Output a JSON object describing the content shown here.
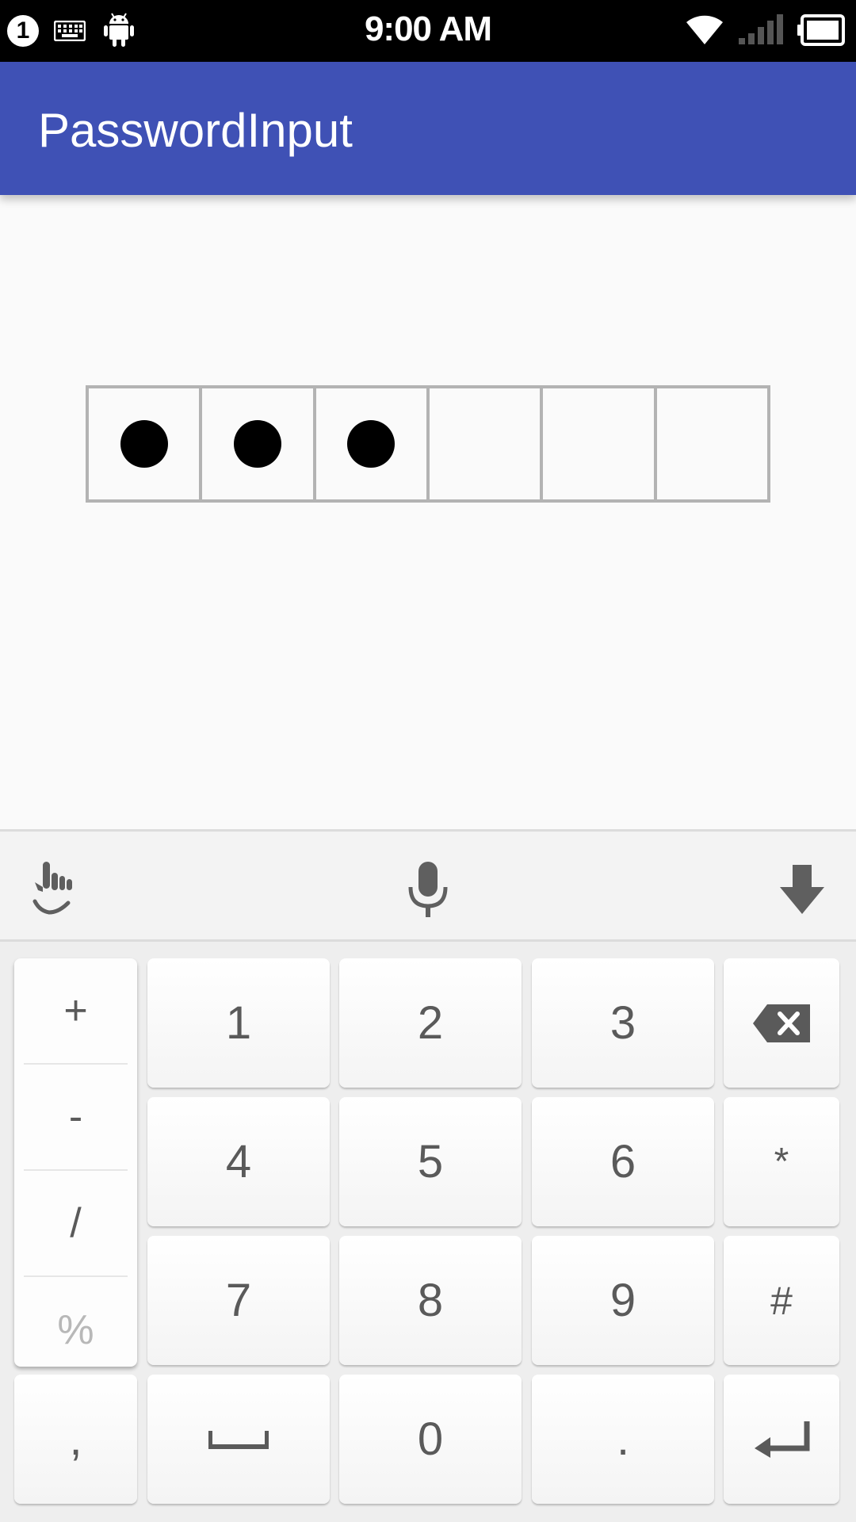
{
  "status_bar": {
    "notification_count": "1",
    "time": "9:00 AM",
    "icons": [
      "keyboard-icon",
      "android-icon",
      "wifi-icon",
      "signal-icon",
      "battery-icon"
    ]
  },
  "app_bar": {
    "title": "PasswordInput",
    "color": "#3f51b5"
  },
  "password_input": {
    "length": 6,
    "filled": 3
  },
  "keyboard": {
    "toolbar": [
      "touch-gesture-icon",
      "microphone-icon",
      "hide-keyboard-icon"
    ],
    "symbols": [
      "+",
      "-",
      "/",
      "%"
    ],
    "rows": [
      [
        "1",
        "2",
        "3",
        "backspace-icon"
      ],
      [
        "4",
        "5",
        "6",
        "*"
      ],
      [
        "7",
        "8",
        "9",
        "#"
      ],
      [
        ",",
        "space-icon",
        "0",
        ".",
        "enter-icon"
      ]
    ],
    "keys": {
      "k1": "1",
      "k2": "2",
      "k3": "3",
      "k4": "4",
      "k5": "5",
      "k6": "6",
      "star": "*",
      "k7": "7",
      "k8": "8",
      "k9": "9",
      "hash": "#",
      "comma": ",",
      "k0": "0",
      "period": "."
    }
  }
}
